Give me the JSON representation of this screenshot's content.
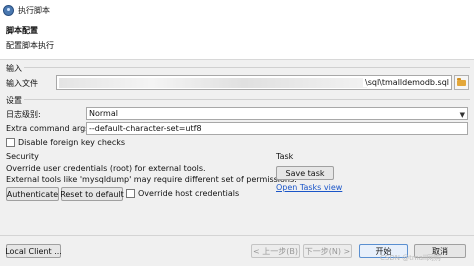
{
  "window": {
    "title": "执行脚本",
    "controls": [
      "—",
      "☐",
      "✕"
    ]
  },
  "header": {
    "title": "脚本配置",
    "subtitle": "配置脚本执行"
  },
  "input_group": {
    "label": "输入",
    "file_label": "输入文件",
    "file_value": "\\sql\\tmalldemodb.sql",
    "browse_icon": "folder-icon"
  },
  "settings_group": {
    "label": "设置",
    "log_level_label": "日志级别:",
    "log_level_value": "Normal",
    "extra_args_label": "Extra command args:",
    "extra_args_value": "--default-character-set=utf8",
    "disable_fk_label": "Disable foreign key checks",
    "disable_fk_checked": false
  },
  "security_group": {
    "label": "Security",
    "line1": "Override user credentials (root) for external tools.",
    "line2": "External tools like 'mysqldump' may require different set of permissions.",
    "authenticate_label": "Authenticate",
    "reset_label": "Reset to default",
    "override_host_label": "Override host credentials",
    "override_host_checked": false
  },
  "task_group": {
    "label": "Task",
    "save_task_label": "Save task",
    "open_tasks_label": "Open Tasks view"
  },
  "footer": {
    "local_client_label": "Local Client ...",
    "back_label": "< 上一步(B)",
    "next_label": "下一步(N) >",
    "start_label": "开始",
    "cancel_label": "取消"
  },
  "watermark": "CSDN @tmall网购"
}
